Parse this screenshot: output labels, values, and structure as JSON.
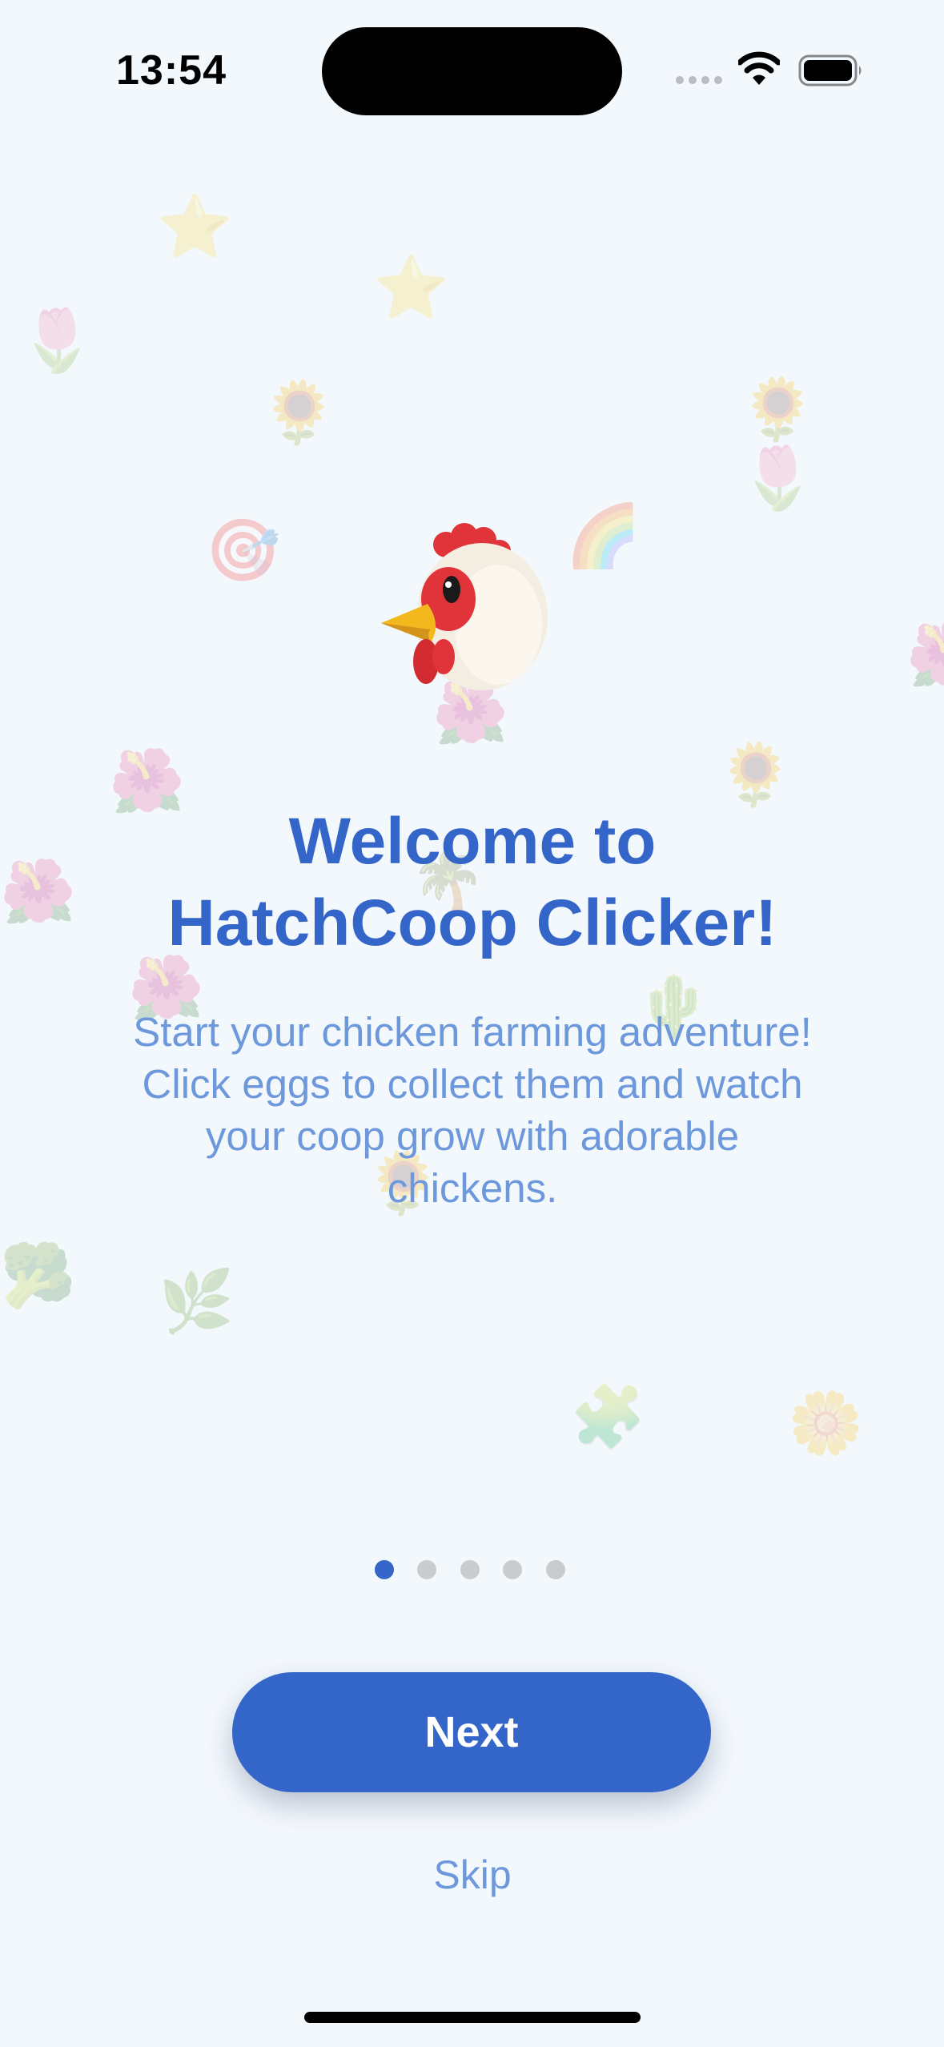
{
  "status_bar": {
    "time": "13:54",
    "signal_icon": "cellular-signal-dots",
    "wifi_icon": "wifi-icon",
    "battery_icon": "battery-full-icon"
  },
  "onboarding": {
    "hero_icon": "chicken-head-icon",
    "title_line1": "Welcome to",
    "title_line2": "HatchCoop Clicker!",
    "description_line1": "Start your chicken farming adventure!",
    "description_line2": "Click eggs to collect them and watch",
    "description_line3": "your coop grow with adorable",
    "description_line4": "chickens.",
    "current_page": 1,
    "page_count": 5,
    "next_label": "Next",
    "skip_label": "Skip"
  },
  "colors": {
    "background": "#f3f8fd",
    "accent": "#3465c9",
    "secondary_text": "#6d98db",
    "inactive_dot": "#c9cbcf"
  }
}
